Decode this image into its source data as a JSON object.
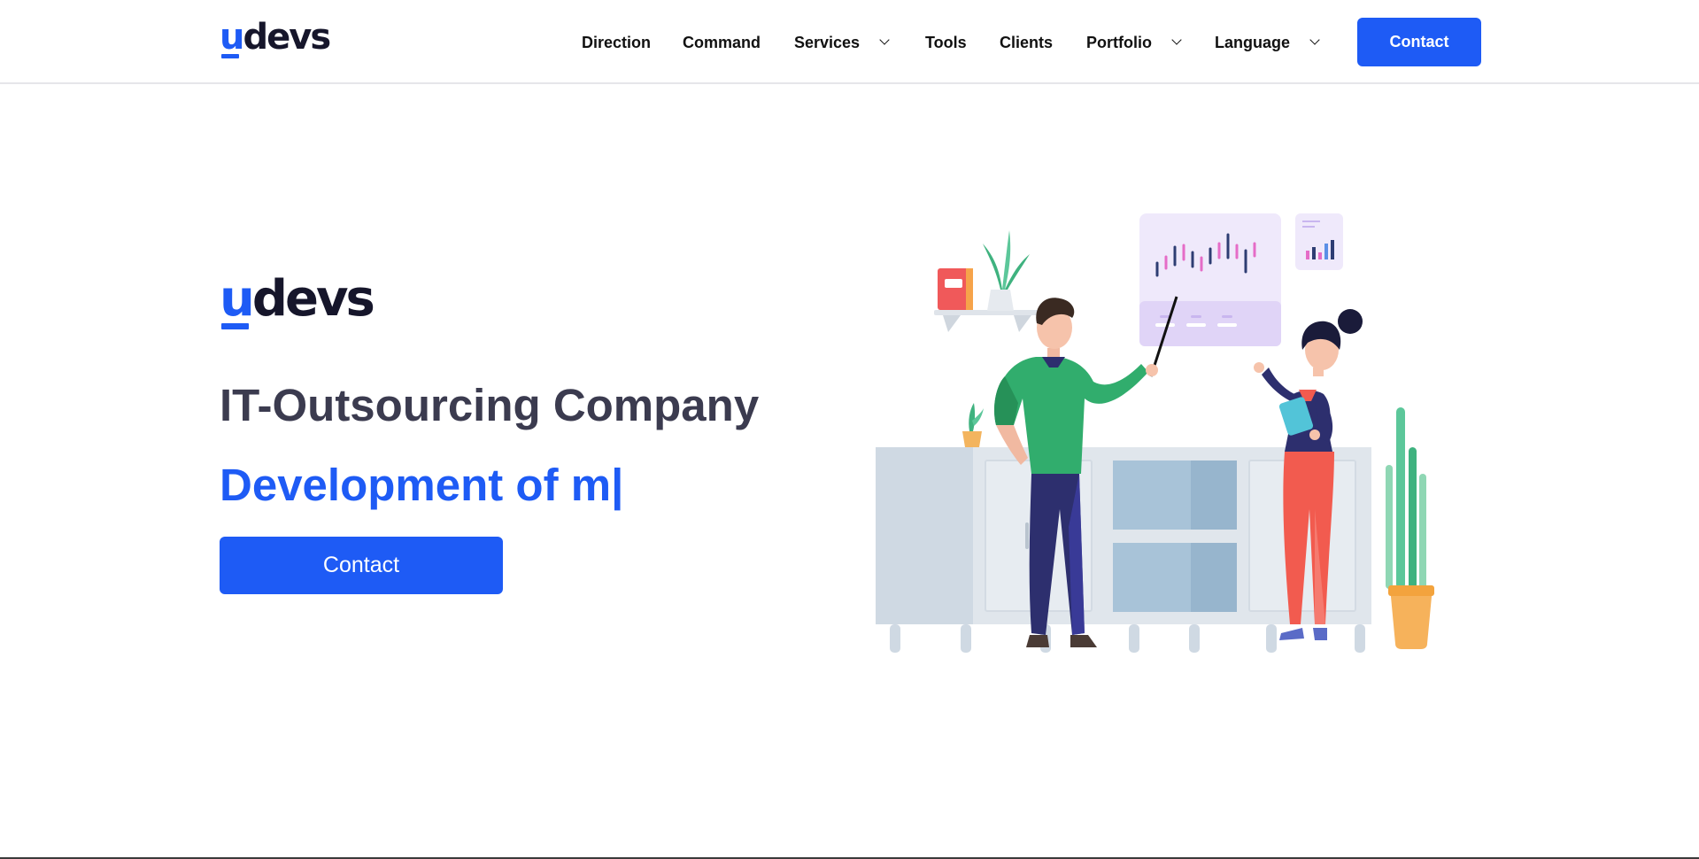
{
  "header": {
    "logo": {
      "u": "u",
      "rest": "devs"
    },
    "nav": [
      {
        "label": "Direction",
        "has_dropdown": false
      },
      {
        "label": "Command",
        "has_dropdown": false
      },
      {
        "label": "Services",
        "has_dropdown": true
      },
      {
        "label": "Tools",
        "has_dropdown": false
      },
      {
        "label": "Clients",
        "has_dropdown": false
      },
      {
        "label": "Portfolio",
        "has_dropdown": true
      },
      {
        "label": "Language",
        "has_dropdown": true
      }
    ],
    "contact_label": "Contact"
  },
  "hero": {
    "logo": {
      "u": "u",
      "rest": "devs"
    },
    "title": "IT-Outsourcing Company",
    "typing_text": "Development of m|",
    "contact_label": "Contact",
    "illustration_icon": "team-presentation-illustration"
  },
  "colors": {
    "accent": "#1e5bf5",
    "title": "#3b3b4f",
    "text": "#111111",
    "logo_dark": "#16162b"
  }
}
